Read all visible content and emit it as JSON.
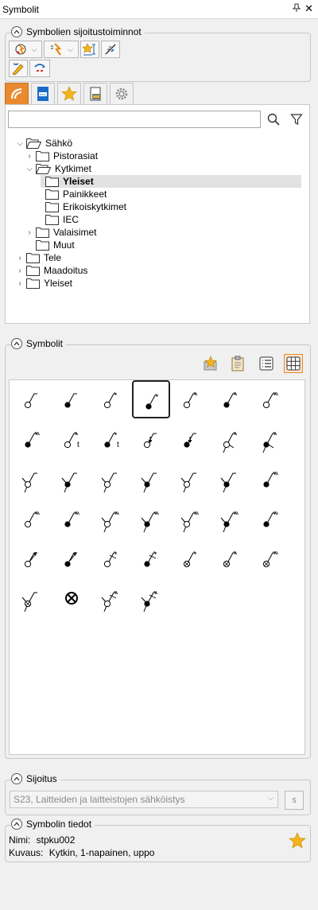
{
  "window": {
    "title": "Symbolit",
    "pin_glyph": "📌",
    "close_glyph": "✕"
  },
  "placement_actions": {
    "title": "Symbolien sijoitustoiminnot",
    "tools": [
      {
        "name": "symbol-tool-1-icon"
      },
      {
        "name": "symbol-tool-2-icon"
      },
      {
        "name": "symbol-tool-3-icon"
      },
      {
        "name": "symbol-tool-4-icon"
      },
      {
        "name": "symbol-tool-5-icon"
      },
      {
        "name": "symbol-tool-6-icon"
      }
    ]
  },
  "tabs": [
    {
      "name": "tab-library",
      "active": true
    },
    {
      "name": "tab-new",
      "active": false
    },
    {
      "name": "tab-favorites",
      "active": false
    },
    {
      "name": "tab-project",
      "active": false
    },
    {
      "name": "tab-settings",
      "active": false
    }
  ],
  "search": {
    "placeholder": "",
    "value": ""
  },
  "tree": [
    {
      "label": "Sähkö",
      "level": 0,
      "expanded": true,
      "open": true
    },
    {
      "label": "Pistorasiat",
      "level": 1,
      "expanded": false
    },
    {
      "label": "Kytkimet",
      "level": 1,
      "expanded": true,
      "open": true
    },
    {
      "label": "Yleiset",
      "level": 2,
      "leaf": true,
      "selected": true
    },
    {
      "label": "Painikkeet",
      "level": 2,
      "leaf": true
    },
    {
      "label": "Erikoiskytkimet",
      "level": 2,
      "leaf": true
    },
    {
      "label": "IEC",
      "level": 2,
      "leaf": true
    },
    {
      "label": "Valaisimet",
      "level": 1,
      "expanded": false
    },
    {
      "label": "Muut",
      "level": 1,
      "leaf": true
    },
    {
      "label": "Tele",
      "level": 0,
      "expanded": false
    },
    {
      "label": "Maadoitus",
      "level": 0,
      "expanded": false
    },
    {
      "label": "Yleiset",
      "level": 0,
      "expanded": false
    }
  ],
  "symbols": {
    "title": "Symbolit",
    "selected_index": 3,
    "items": [
      {
        "id": "s01",
        "fill": "open",
        "ticks": 0
      },
      {
        "id": "s02",
        "fill": "solid",
        "ticks": 0
      },
      {
        "id": "s03",
        "fill": "open",
        "ticks": 1
      },
      {
        "id": "s04",
        "fill": "solid",
        "ticks": 1
      },
      {
        "id": "s05",
        "fill": "open",
        "ticks": 2
      },
      {
        "id": "s06",
        "fill": "solid",
        "ticks": 2
      },
      {
        "id": "s07",
        "fill": "open",
        "ticks": 3
      },
      {
        "id": "s08",
        "fill": "solid",
        "ticks": 3
      },
      {
        "id": "s09",
        "fill": "open",
        "ticks": 2,
        "label": "t"
      },
      {
        "id": "s10",
        "fill": "solid",
        "ticks": 1,
        "label": "t"
      },
      {
        "id": "s11",
        "fill": "open",
        "ticks": 0,
        "arrow": true
      },
      {
        "id": "s12",
        "fill": "solid",
        "ticks": 0,
        "arrow": true
      },
      {
        "id": "s13",
        "fill": "open",
        "ticks": 2,
        "two": true
      },
      {
        "id": "s14",
        "fill": "solid",
        "ticks": 2,
        "two": true
      },
      {
        "id": "s15",
        "fill": "open",
        "cross": true
      },
      {
        "id": "s16",
        "fill": "solid",
        "cross": true
      },
      {
        "id": "s17",
        "fill": "open",
        "cross": true
      },
      {
        "id": "s18",
        "fill": "solid",
        "cross": true
      },
      {
        "id": "s19",
        "fill": "open",
        "cross": true
      },
      {
        "id": "s20",
        "fill": "solid",
        "cross": true
      },
      {
        "id": "s21",
        "fill": "solid",
        "ticks": 3
      },
      {
        "id": "s22",
        "fill": "open",
        "ticks": 3
      },
      {
        "id": "s23",
        "fill": "solid",
        "ticks": 3
      },
      {
        "id": "s24",
        "fill": "open",
        "ticks": 3,
        "cross": true
      },
      {
        "id": "s25",
        "fill": "solid",
        "ticks": 3,
        "cross": true
      },
      {
        "id": "s26",
        "fill": "open",
        "ticks": 3,
        "cross": true
      },
      {
        "id": "s27",
        "fill": "solid",
        "ticks": 3,
        "cross": true
      },
      {
        "id": "s28",
        "fill": "solid",
        "ticks": 3
      },
      {
        "id": "s29",
        "fill": "open",
        "arrow2": true
      },
      {
        "id": "s30",
        "fill": "solid",
        "arrow2": true
      },
      {
        "id": "s31",
        "fill": "open",
        "ticks": 1,
        "slash": true
      },
      {
        "id": "s32",
        "fill": "solid",
        "ticks": 1,
        "slash": true
      },
      {
        "id": "s33",
        "fill": "xcircle",
        "ticks": 1
      },
      {
        "id": "s34",
        "fill": "xcircle",
        "ticks": 2
      },
      {
        "id": "s35",
        "fill": "xcircle",
        "ticks": 3
      },
      {
        "id": "s36",
        "fill": "xcircle",
        "cross": true
      },
      {
        "id": "s37",
        "fill": "xbig"
      },
      {
        "id": "s38",
        "fill": "open",
        "ticks": 2,
        "cross": true,
        "slash": true
      },
      {
        "id": "s39",
        "fill": "solid",
        "ticks": 2,
        "cross": true,
        "slash": true
      }
    ]
  },
  "placement": {
    "title": "Sijoitus",
    "value": "S23, Laitteiden ja laitteistojen sähköistys",
    "badge": "S"
  },
  "details": {
    "title": "Symbolin tiedot",
    "name_label": "Nimi:",
    "name_value": "stpku002",
    "desc_label": "Kuvaus:",
    "desc_value": "Kytkin, 1-napainen, uppo"
  },
  "colors": {
    "accent": "#e98a30",
    "star": "#f5b41a",
    "blue": "#1a63b5"
  }
}
